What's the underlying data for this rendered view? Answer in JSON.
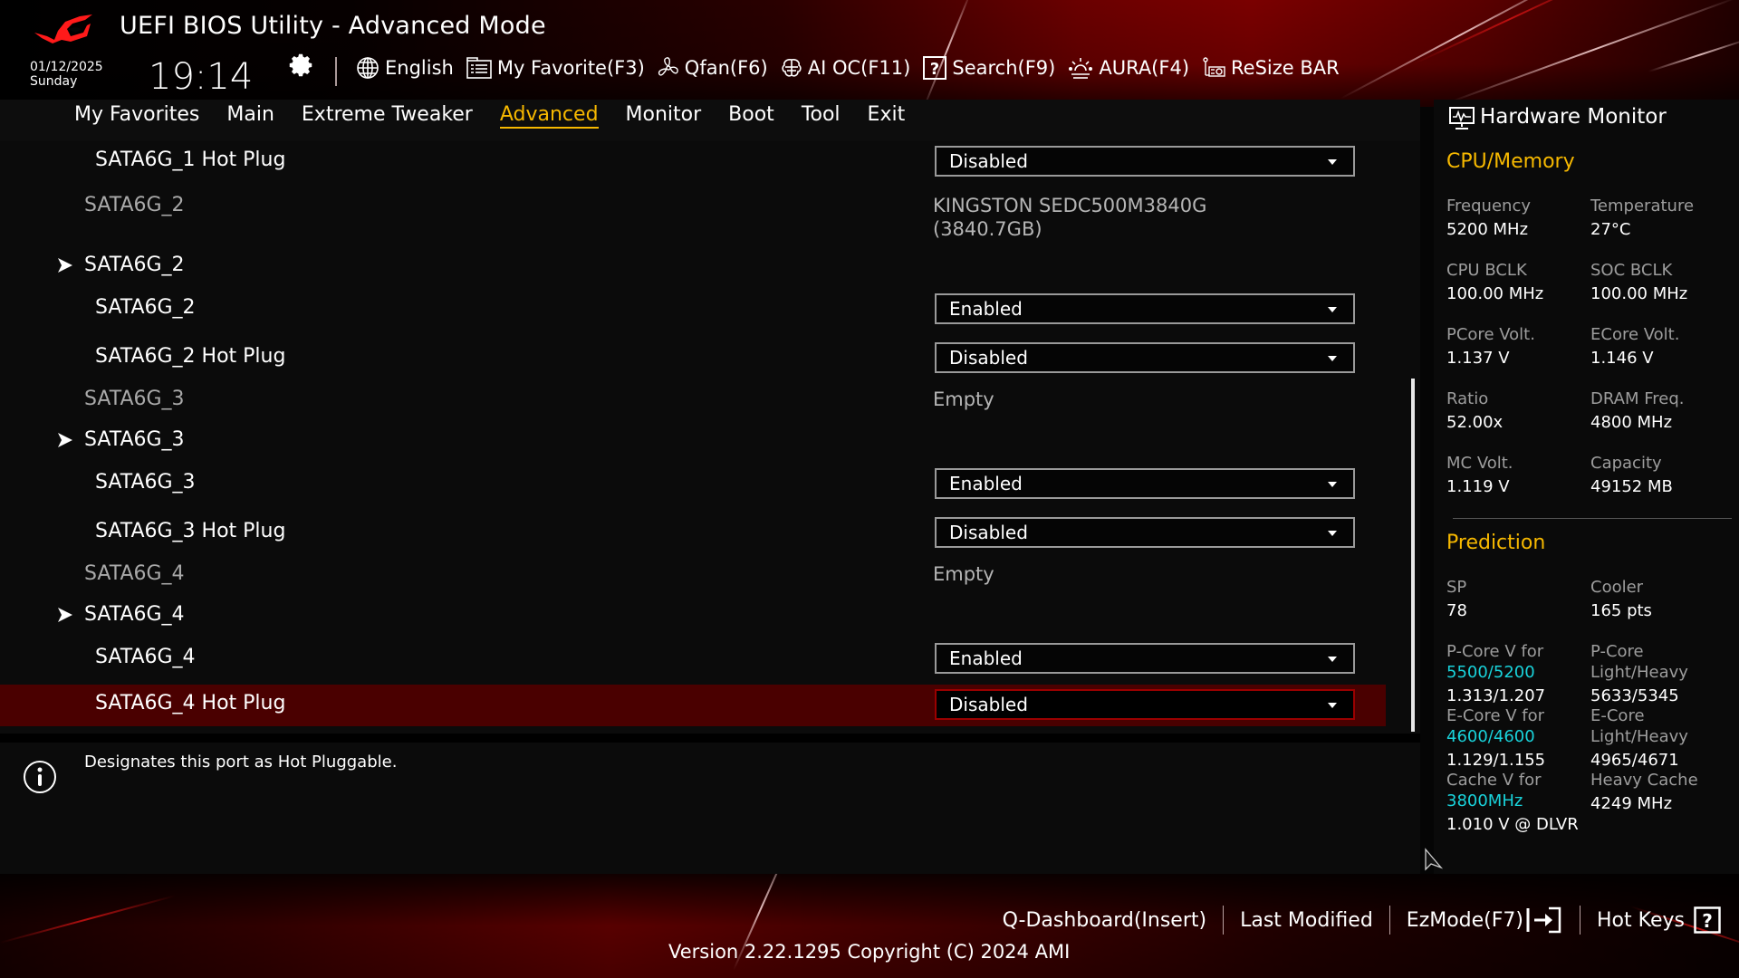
{
  "app": {
    "title": "UEFI BIOS Utility - Advanced Mode",
    "date": "01/12/2025",
    "day": "Sunday",
    "time": "19:14"
  },
  "toolbar": [
    {
      "icon": "globe-icon",
      "label": "English"
    },
    {
      "icon": "favorites-list-icon",
      "label": "My Favorite(F3)"
    },
    {
      "icon": "fan-icon",
      "label": "Qfan(F6)"
    },
    {
      "icon": "ai-brain-icon",
      "label": "AI OC(F11)"
    },
    {
      "icon": "search-help-icon",
      "label": "Search(F9)"
    },
    {
      "icon": "aura-light-icon",
      "label": "AURA(F4)"
    },
    {
      "icon": "gpu-card-icon",
      "label": "ReSize BAR"
    }
  ],
  "tabs": [
    {
      "label": "My Favorites",
      "active": false
    },
    {
      "label": "Main",
      "active": false
    },
    {
      "label": "Extreme Tweaker",
      "active": false
    },
    {
      "label": "Advanced",
      "active": true
    },
    {
      "label": "Monitor",
      "active": false
    },
    {
      "label": "Boot",
      "active": false
    },
    {
      "label": "Tool",
      "active": false
    },
    {
      "label": "Exit",
      "active": false
    }
  ],
  "settings": [
    {
      "type": "select",
      "label": "SATA6G_1 Hot Plug",
      "value": "Disabled"
    },
    {
      "type": "info",
      "label": "SATA6G_2",
      "value_lines": [
        "KINGSTON SEDC500M3840G",
        "(3840.7GB)"
      ]
    },
    {
      "type": "submenu",
      "label": "SATA6G_2"
    },
    {
      "type": "select",
      "label": "SATA6G_2",
      "value": "Enabled"
    },
    {
      "type": "select",
      "label": "SATA6G_2 Hot Plug",
      "value": "Disabled"
    },
    {
      "type": "info",
      "label": "SATA6G_3",
      "value_lines": [
        "Empty"
      ]
    },
    {
      "type": "submenu",
      "label": "SATA6G_3"
    },
    {
      "type": "select",
      "label": "SATA6G_3",
      "value": "Enabled"
    },
    {
      "type": "select",
      "label": "SATA6G_3 Hot Plug",
      "value": "Disabled"
    },
    {
      "type": "info",
      "label": "SATA6G_4",
      "value_lines": [
        "Empty"
      ]
    },
    {
      "type": "submenu",
      "label": "SATA6G_4"
    },
    {
      "type": "select",
      "label": "SATA6G_4",
      "value": "Enabled"
    },
    {
      "type": "select",
      "label": "SATA6G_4 Hot Plug",
      "value": "Disabled",
      "selected": true
    }
  ],
  "help": {
    "text": "Designates this port as Hot Pluggable."
  },
  "hardware_monitor": {
    "title": "Hardware Monitor",
    "cpu_memory": {
      "heading": "CPU/Memory",
      "items": [
        {
          "label": "Frequency",
          "value": "5200 MHz"
        },
        {
          "label": "Temperature",
          "value": "27°C"
        },
        {
          "label": "CPU BCLK",
          "value": "100.00 MHz"
        },
        {
          "label": "SOC BCLK",
          "value": "100.00 MHz"
        },
        {
          "label": "PCore Volt.",
          "value": "1.137 V"
        },
        {
          "label": "ECore Volt.",
          "value": "1.146 V"
        },
        {
          "label": "Ratio",
          "value": "52.00x"
        },
        {
          "label": "DRAM Freq.",
          "value": "4800 MHz"
        },
        {
          "label": "MC Volt.",
          "value": "1.119 V"
        },
        {
          "label": "Capacity",
          "value": "49152 MB"
        }
      ]
    },
    "prediction": {
      "heading": "Prediction",
      "sp_label": "SP",
      "sp_value": "78",
      "cooler_label": "Cooler",
      "cooler_value": "165 pts",
      "pcore_v_label": "P-Core V for",
      "pcore_v_freq": "5500/5200",
      "pcore_v_value": "1.313/1.207",
      "pcore_lh_label1": "P-Core",
      "pcore_lh_label2": "Light/Heavy",
      "pcore_lh_value": "5633/5345",
      "ecore_v_label": "E-Core V for",
      "ecore_v_freq": "4600/4600",
      "ecore_v_value": "1.129/1.155",
      "ecore_lh_label1": "E-Core",
      "ecore_lh_label2": "Light/Heavy",
      "ecore_lh_value": "4965/4671",
      "cache_v_label": "Cache V for",
      "cache_v_freq": "3800MHz",
      "cache_v_value": "1.010 V @ DLVR",
      "heavy_cache_label": "Heavy Cache",
      "heavy_cache_value": "4249 MHz"
    }
  },
  "footer": {
    "q_dashboard": "Q-Dashboard(Insert)",
    "last_modified": "Last Modified",
    "ezmode": "EzMode(F7)",
    "hot_keys": "Hot Keys",
    "version": "Version 2.22.1295 Copyright (C) 2024 AMI"
  },
  "colors": {
    "accent": "#f6b800",
    "highlight_row": "#4a0000",
    "prediction_freq": "#19d3db"
  }
}
